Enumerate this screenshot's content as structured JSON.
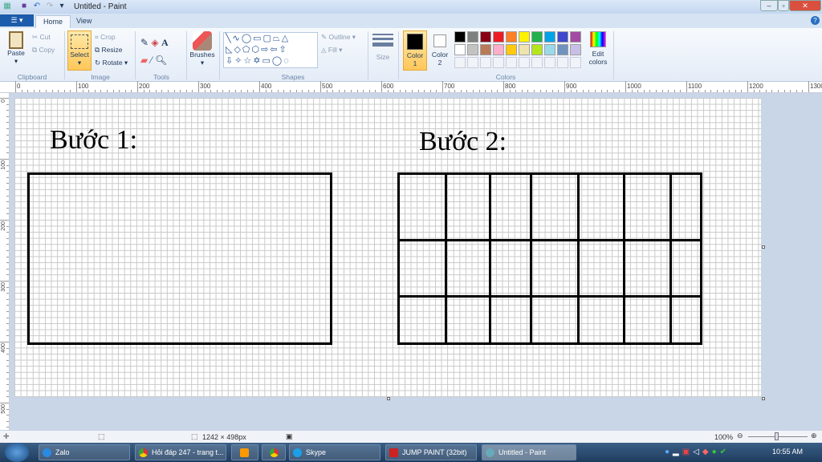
{
  "window": {
    "title": "Untitled - Paint"
  },
  "tabs": [
    {
      "label": "Home"
    },
    {
      "label": "View"
    }
  ],
  "clipboard": {
    "group": "Clipboard",
    "paste": "Paste",
    "cut": "Cut",
    "copy": "Copy"
  },
  "image": {
    "group": "Image",
    "select": "Select",
    "crop": "Crop",
    "resize": "Resize",
    "rotate": "Rotate"
  },
  "tools": {
    "group": "Tools"
  },
  "brushes": {
    "label": "Brushes"
  },
  "shapes": {
    "group": "Shapes",
    "outline": "Outline",
    "fill": "Fill"
  },
  "size": {
    "label": "Size"
  },
  "colors": {
    "group": "Colors",
    "color1": "Color 1",
    "color2": "Color 2",
    "edit": "Edit colors",
    "color1_value": "#000000",
    "color2_value": "#ffffff",
    "palette": [
      "#000000",
      "#7f7f7f",
      "#880015",
      "#ed1c24",
      "#ff7f27",
      "#fff200",
      "#22b14c",
      "#00a2e8",
      "#3f48cc",
      "#a349a4",
      "#ffffff",
      "#c3c3c3",
      "#b97a57",
      "#ffaec9",
      "#ffc90e",
      "#efe4b0",
      "#b5e61d",
      "#99d9ea",
      "#7092be",
      "#c8bfe7"
    ]
  },
  "canvas": {
    "step1": "Bước 1:",
    "step2": "Bước 2:"
  },
  "status": {
    "dimensions": "1242 × 498px",
    "zoom": "100%"
  },
  "taskbar": {
    "items": [
      {
        "label": "Zalo"
      },
      {
        "label": "Hỏi đáp 247 - trang t..."
      },
      {
        "label": "Skype"
      },
      {
        "label": "JUMP PAINT (32bit)"
      },
      {
        "label": "Untitled - Paint"
      }
    ],
    "clock": "10:55 AM"
  }
}
